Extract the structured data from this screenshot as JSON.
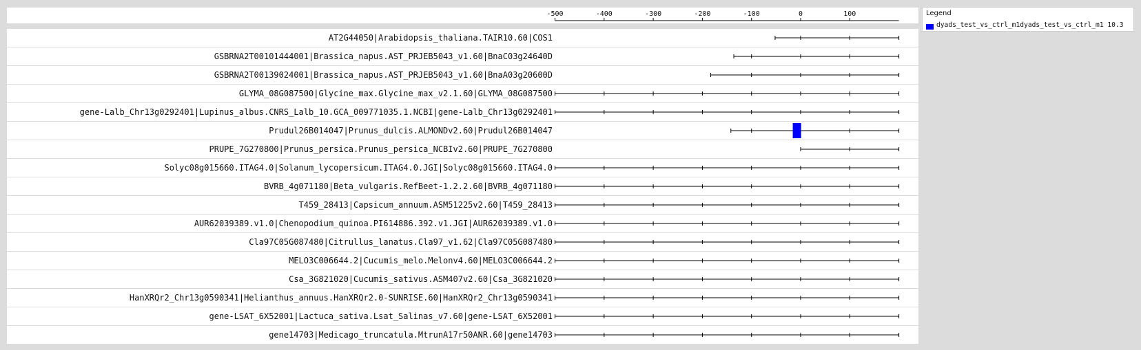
{
  "chart_data": {
    "type": "bar",
    "x_axis": {
      "ticks": [
        -500,
        -400,
        -300,
        -200,
        -100,
        0,
        100
      ],
      "range": [
        -500,
        200
      ]
    },
    "rows": [
      {
        "label": "AT2G44050|Arabidopsis_thaliana.TAIR10.60|COS1",
        "line_start": -52,
        "line_end": 200
      },
      {
        "label": "GSBRNA2T00101444001|Brassica_napus.AST_PRJEB5043_v1.60|BnaC03g24640D",
        "line_start": -136,
        "line_end": 200
      },
      {
        "label": "GSBRNA2T00139024001|Brassica_napus.AST_PRJEB5043_v1.60|BnaA03g20600D",
        "line_start": -183,
        "line_end": 200
      },
      {
        "label": "GLYMA_08G087500|Glycine_max.Glycine_max_v2.1.60|GLYMA_08G087500",
        "line_start": -500,
        "line_end": 200
      },
      {
        "label": "gene-Lalb_Chr13g0292401|Lupinus_albus.CNRS_Lalb_10.GCA_009771035.1.NCBI|gene-Lalb_Chr13g0292401",
        "line_start": -500,
        "line_end": 200
      },
      {
        "label": "Prudul26B014047|Prunus_dulcis.ALMONDv2.60|Prudul26B014047",
        "line_start": -142,
        "line_end": 200,
        "features": [
          {
            "series": "dyads_test_vs_ctrl_m1",
            "start": -16,
            "end": 1
          }
        ]
      },
      {
        "label": "PRUPE_7G270800|Prunus_persica.Prunus_persica_NCBIv2.60|PRUPE_7G270800",
        "line_start": 0,
        "line_end": 200
      },
      {
        "label": "Solyc08g015660.ITAG4.0|Solanum_lycopersicum.ITAG4.0.JGI|Solyc08g015660.ITAG4.0",
        "line_start": -500,
        "line_end": 200
      },
      {
        "label": "BVRB_4g071180|Beta_vulgaris.RefBeet-1.2.2.60|BVRB_4g071180",
        "line_start": -500,
        "line_end": 200
      },
      {
        "label": "T459_28413|Capsicum_annuum.ASM51225v2.60|T459_28413",
        "line_start": -500,
        "line_end": 200
      },
      {
        "label": "AUR62039389.v1.0|Chenopodium_quinoa.PI614886.392.v1.JGI|AUR62039389.v1.0",
        "line_start": -500,
        "line_end": 200
      },
      {
        "label": "Cla97C05G087480|Citrullus_lanatus.Cla97_v1.62|Cla97C05G087480",
        "line_start": -500,
        "line_end": 200
      },
      {
        "label": "MELO3C006644.2|Cucumis_melo.Melonv4.60|MELO3C006644.2",
        "line_start": -500,
        "line_end": 200
      },
      {
        "label": "Csa_3G821020|Cucumis_sativus.ASM407v2.60|Csa_3G821020",
        "line_start": -500,
        "line_end": 200
      },
      {
        "label": "HanXRQr2_Chr13g0590341|Helianthus_annuus.HanXRQr2.0-SUNRISE.60|HanXRQr2_Chr13g0590341",
        "line_start": -500,
        "line_end": 200
      },
      {
        "label": "gene-LSAT_6X52001|Lactuca_sativa.Lsat_Salinas_v7.60|gene-LSAT_6X52001",
        "line_start": -500,
        "line_end": 200
      },
      {
        "label": "gene14703|Medicago_truncatula.MtrunA17r50ANR.60|gene14703",
        "line_start": -500,
        "line_end": 200
      }
    ],
    "legend": {
      "title": "Legend",
      "placement": "top-right",
      "entries": [
        {
          "label": "dyads_test_vs_ctrl_m1dyads_test_vs_ctrl_m1 10.3",
          "color": "#0000ff"
        }
      ]
    },
    "grid": false
  },
  "colors": {
    "background": "#dcdcdc",
    "panel": "#ffffff",
    "feature": "#0000ff",
    "line": "#000000"
  }
}
